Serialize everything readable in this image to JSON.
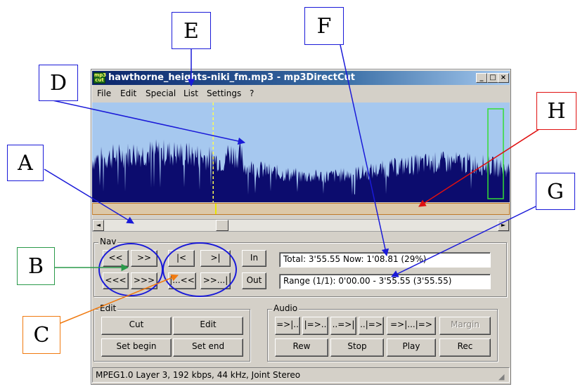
{
  "window": {
    "title": "hawthorne_heights-niki_fm.mp3 - mp3DirectCut",
    "app_icon_text": "mp3 cut",
    "min_glyph": "_",
    "max_glyph": "□",
    "close_glyph": "×"
  },
  "menu": [
    {
      "label": "File"
    },
    {
      "label": "Edit"
    },
    {
      "label": "Special"
    },
    {
      "label": "List"
    },
    {
      "label": "Settings"
    },
    {
      "label": "?"
    }
  ],
  "scrollbar": {
    "left_arrow": "◄",
    "right_arrow": "►"
  },
  "nav": {
    "label": "Nav",
    "buttons": [
      "<<",
      ">>",
      "|<",
      ">|",
      "<<<",
      ">>>",
      "|...<<",
      ">>...|"
    ],
    "in_label": "In",
    "out_label": "Out",
    "total_text": "Total: 3'55.55   Now: 1'08.81   (29%)",
    "range_text": "Range (1/1): 0'00.00 - 3'55.55 (3'55.55)"
  },
  "edit": {
    "label": "Edit",
    "cut_label": "Cut",
    "edit_label": "Edit",
    "set_begin_label": "Set begin",
    "set_end_label": "Set end"
  },
  "audio": {
    "label": "Audio",
    "buttons_row1": [
      "=>|..",
      "|=>..",
      "..=>|",
      "..|=>",
      "=>|...|=>",
      "Margin"
    ],
    "buttons_row2": [
      "Rew",
      "Stop",
      "Play",
      "Rec"
    ]
  },
  "status_text": "MPEG1.0 Layer 3, 192 kbps, 44 kHz, Joint Stereo",
  "playback_position_fraction": 0.29,
  "colors": {
    "waveform_fill": "#0c0c6e",
    "waveform_bg": "#a6c8ef",
    "cursor_line": "#ffff55",
    "selection_box": "#33dd33"
  },
  "callouts": {
    "A": "A",
    "B": "B",
    "C": "C",
    "D": "D",
    "E": "E",
    "F": "F",
    "G": "G",
    "H": "H"
  }
}
